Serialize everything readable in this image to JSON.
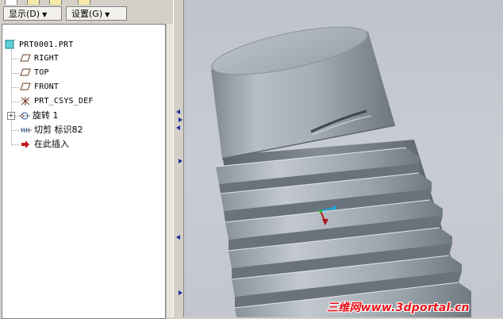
{
  "toolbar": {
    "display_menu": "显示",
    "display_shortcut": "(D)",
    "settings_menu": "设置",
    "settings_shortcut": "(G)"
  },
  "model_tree": {
    "root": "PRT0001.PRT",
    "items": [
      {
        "label": "RIGHT",
        "icon": "datum-plane-icon"
      },
      {
        "label": "TOP",
        "icon": "datum-plane-icon"
      },
      {
        "label": "FRONT",
        "icon": "datum-plane-icon"
      },
      {
        "label": "PRT_CSYS_DEF",
        "icon": "coordinate-system-icon"
      },
      {
        "label": "旋转 1",
        "icon": "revolve-feature-icon"
      },
      {
        "label": "切剪 标识82",
        "icon": "helical-cut-icon"
      },
      {
        "label": "在此插入",
        "icon": "insert-here-arrow-icon"
      }
    ]
  },
  "viewport": {
    "watermark": "三维网www.3dportal.cn"
  },
  "colors": {
    "ui_background": "#d4d0c8",
    "model_gray": "#a9b1b9",
    "watermark_red": "#e8131a"
  }
}
